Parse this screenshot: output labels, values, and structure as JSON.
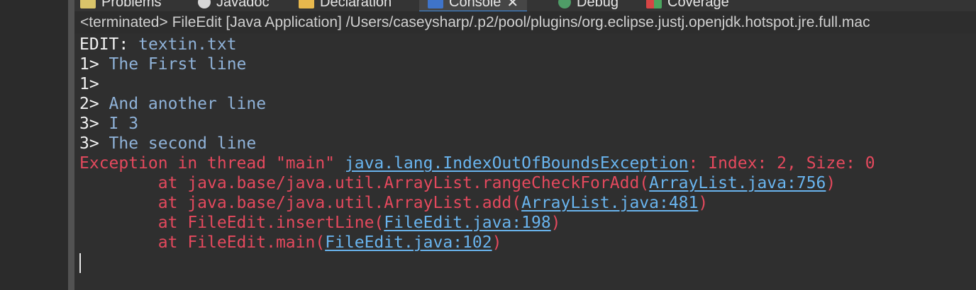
{
  "tabs": [
    {
      "label": "Problems",
      "icon": "problems-icon"
    },
    {
      "label": "Javadoc",
      "icon": "javadoc-icon"
    },
    {
      "label": "Declaration",
      "icon": "declaration-icon"
    },
    {
      "label": "Console",
      "icon": "console-icon",
      "close": "✕"
    },
    {
      "label": "Debug",
      "icon": "debug-icon"
    },
    {
      "label": "Coverage",
      "icon": "coverage-icon"
    }
  ],
  "header": {
    "status": "<terminated> FileEdit [Java Application] /Users/caseysharp/.p2/pool/plugins/org.eclipse.justj.openjdk.hotspot.jre.full.mac"
  },
  "console": {
    "lines": [
      {
        "prompt": "EDIT: ",
        "text": "textin.txt"
      },
      {
        "prompt": "1> ",
        "text": "The First line"
      },
      {
        "prompt": "1> ",
        "text": ""
      },
      {
        "prompt": "2> ",
        "text": "And another line"
      },
      {
        "prompt": "3> ",
        "text": "I 3"
      },
      {
        "prompt": "3> ",
        "text": "The second line"
      }
    ],
    "exception": {
      "prefix": "Exception in thread \"main\" ",
      "class_link": "java.lang.IndexOutOfBoundsException",
      "message": ": Index: 2, Size: 0"
    },
    "stack": [
      {
        "prefix": "        at java.base/java.util.ArrayList.rangeCheckForAdd(",
        "link": "ArrayList.java:756",
        "suffix": ")"
      },
      {
        "prefix": "        at java.base/java.util.ArrayList.add(",
        "link": "ArrayList.java:481",
        "suffix": ")"
      },
      {
        "prefix": "        at FileEdit.insertLine(",
        "link": "FileEdit.java:198",
        "suffix": ")"
      },
      {
        "prefix": "        at FileEdit.main(",
        "link": "FileEdit.java:102",
        "suffix": ")"
      }
    ]
  },
  "colors": {
    "background": "#2f2f2f",
    "prompt": "#f2f2f2",
    "input": "#8fb2d8",
    "error": "#e4495d",
    "link": "#69b4ee",
    "tab_underline": "#3f8ee6"
  }
}
